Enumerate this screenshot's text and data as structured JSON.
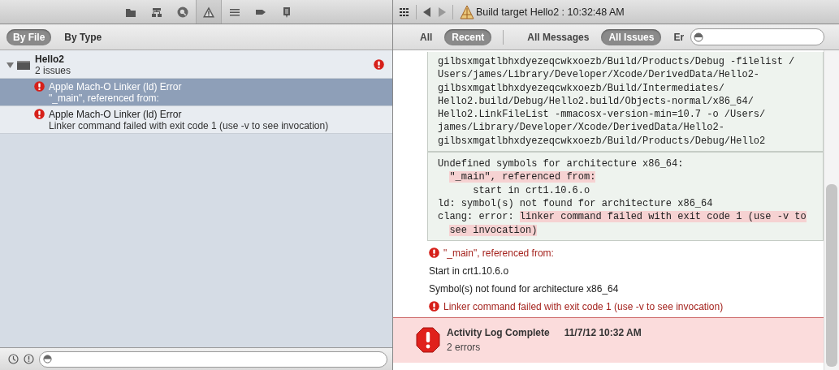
{
  "navigator": {
    "tabs": [
      {
        "kind": "folder",
        "selected": false
      },
      {
        "kind": "hierarchy",
        "selected": false
      },
      {
        "kind": "search",
        "selected": false
      },
      {
        "kind": "warning",
        "selected": true
      },
      {
        "kind": "list",
        "selected": false
      },
      {
        "kind": "tag",
        "selected": false
      },
      {
        "kind": "speech",
        "selected": false
      }
    ],
    "filters": [
      {
        "label": "By File",
        "selected": true
      },
      {
        "label": "By Type",
        "selected": false
      }
    ],
    "tree": {
      "title": "Hello2",
      "subtitle": "2 issues",
      "expanded": true,
      "children": [
        {
          "title": "Apple Mach-O Linker (ld) Error",
          "detail": "\"_main\", referenced from:",
          "selected": true
        },
        {
          "title": "Apple Mach-O Linker (ld) Error",
          "detail": "Linker command failed with exit code 1 (use -v to see invocation)",
          "selected": false
        }
      ]
    }
  },
  "log": {
    "jump_bar": {
      "title": "Build target Hello2 : 10:32:48 AM"
    },
    "scope_groups": [
      [
        {
          "label": "All",
          "selected": false
        },
        {
          "label": "Recent",
          "selected": true
        }
      ],
      [
        {
          "label": "All Messages",
          "selected": false
        },
        {
          "label": "All Issues",
          "selected": true
        },
        {
          "label": "Er",
          "selected": false
        }
      ]
    ],
    "command_output": [
      "gilbsxmgatlbhxdyezeqcwkxoezb/Build/Products/Debug -filelist /",
      "Users/james/Library/Developer/Xcode/DerivedData/Hello2-",
      "gilbsxmgatlbhxdyezeqcwkxoezb/Build/Intermediates/",
      "Hello2.build/Debug/Hello2.build/Objects-normal/x86_64/",
      "Hello2.LinkFileList -mmacosx-version-min=10.7 -o /Users/",
      "james/Library/Developer/Xcode/DerivedData/Hello2-",
      "gilbsxmgatlbhxdyezeqcwkxoezb/Build/Products/Debug/Hello2"
    ],
    "error_output": [
      {
        "kind": "plain",
        "segments": [
          {
            "text": "Undefined symbols for architecture x86_64:",
            "highlight": false
          }
        ]
      },
      {
        "kind": "indented",
        "segments": [
          {
            "text": "\"_main\", referenced from:",
            "highlight": true
          }
        ]
      },
      {
        "kind": "nested",
        "segments": [
          {
            "text": "start in crt1.10.6.o",
            "highlight": false
          }
        ]
      },
      {
        "kind": "plain",
        "segments": [
          {
            "text": "ld: symbol(s) not found for architecture x86_64",
            "highlight": false
          }
        ]
      },
      {
        "kind": "plain",
        "segments": [
          {
            "text": "clang: error: ",
            "highlight": false
          },
          {
            "text": "linker command failed with exit code 1 (use -v to",
            "highlight": true
          }
        ]
      },
      {
        "kind": "indented",
        "segments": [
          {
            "text": "see invocation)",
            "highlight": true
          }
        ]
      }
    ],
    "messages": [
      {
        "kind": "error",
        "text": "\"_main\", referenced from:"
      },
      {
        "kind": "note",
        "text": "Start in crt1.10.6.o"
      },
      {
        "kind": "note",
        "text": "Symbol(s) not found for architecture x86_64"
      },
      {
        "kind": "error",
        "text": "Linker command failed with exit code 1 (use -v to see invocation)"
      }
    ],
    "summary": {
      "title": "Activity Log Complete",
      "time": "11/7/12 10:32 AM",
      "detail": "2 errors"
    }
  }
}
